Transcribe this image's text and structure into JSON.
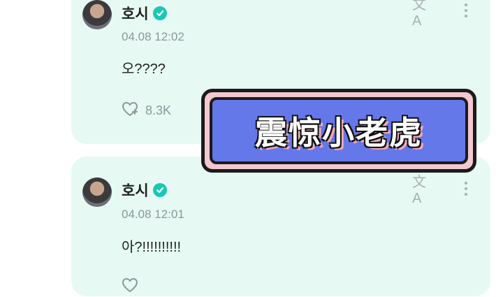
{
  "posts": [
    {
      "author": "호시",
      "timestamp": "04.08 12:02",
      "text": "오????",
      "likes": "8.3K",
      "verified": true
    },
    {
      "author": "호시",
      "timestamp": "04.08 12:01",
      "text": "아?!!!!!!!!!!",
      "likes": "",
      "verified": true
    }
  ],
  "overlay": {
    "caption": "震惊小老虎"
  },
  "icons": {
    "translate": "translate-icon",
    "more": "more-vertical-icon",
    "like": "heart-plus-icon",
    "verified": "verified-badge-icon"
  },
  "colors": {
    "card_background": "#e6faf3",
    "verified": "#18c8b6",
    "banner_fill": "#6578ea",
    "banner_frame": "#f4c8cf"
  }
}
